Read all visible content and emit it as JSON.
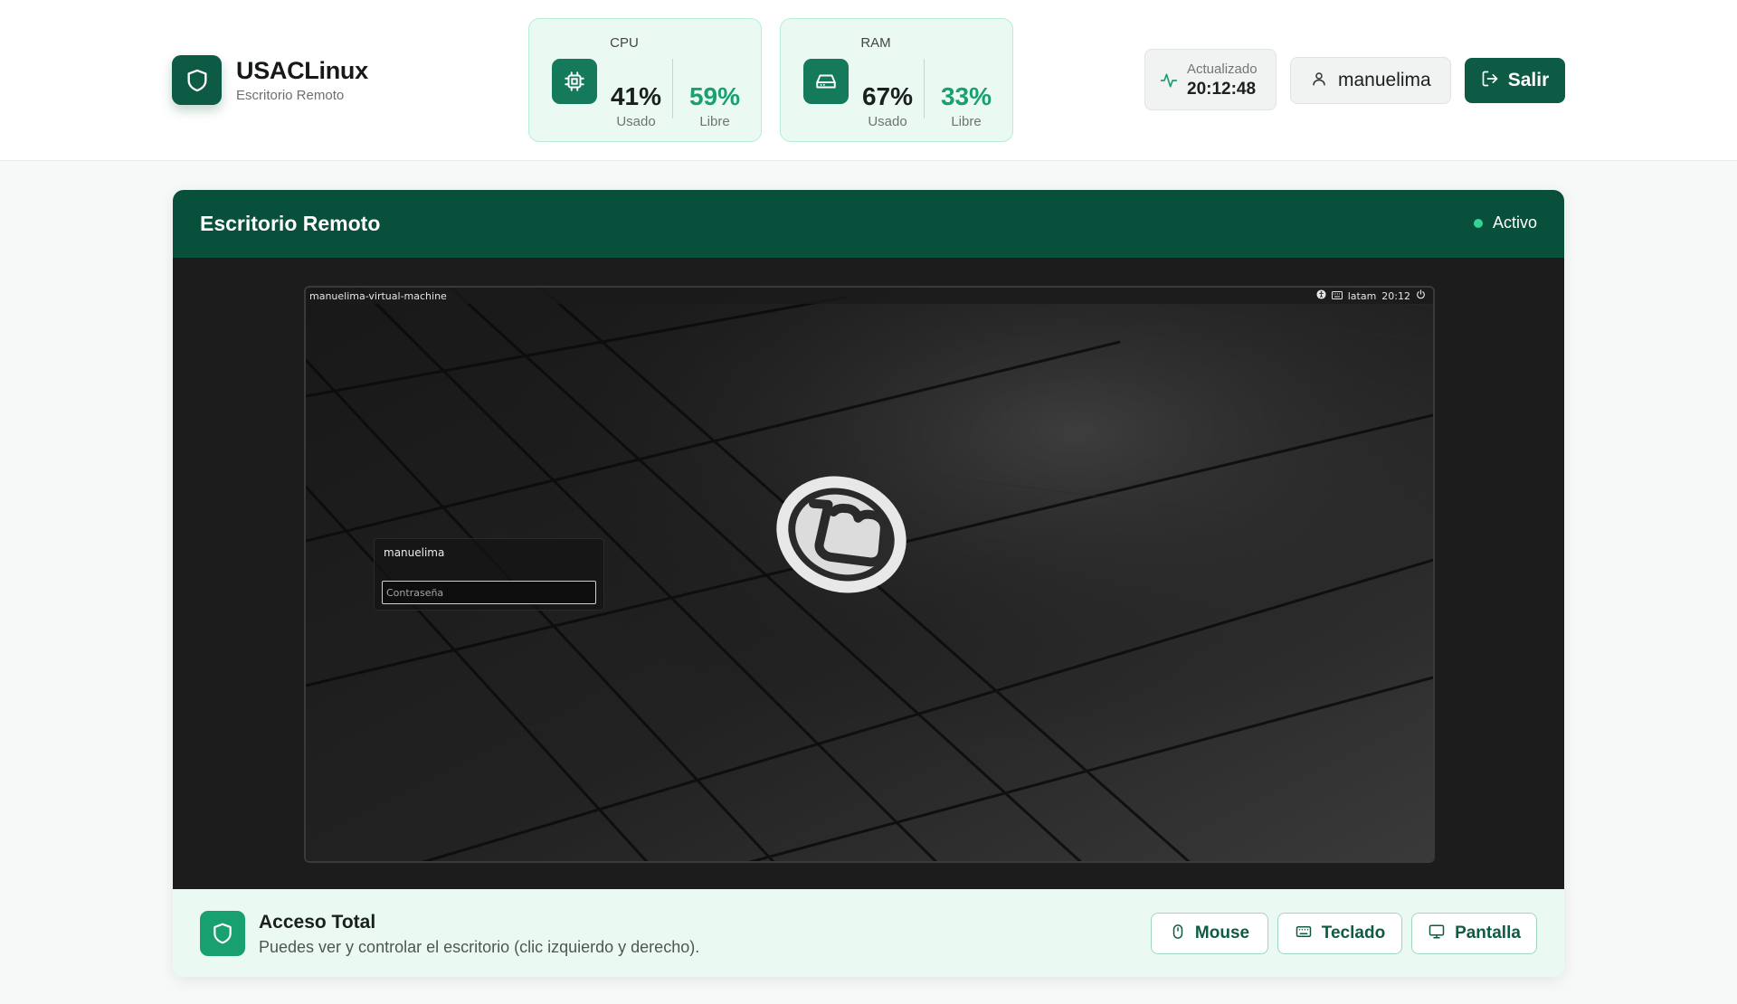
{
  "brand": {
    "title": "USACLinux",
    "subtitle": "Escritorio Remoto",
    "icon": "shield-icon"
  },
  "stats": {
    "cpu": {
      "label": "CPU",
      "icon": "cpu-chip-icon",
      "used": "41%",
      "used_label": "Usado",
      "free": "59%",
      "free_label": "Libre"
    },
    "ram": {
      "label": "RAM",
      "icon": "hard-drive-icon",
      "used": "67%",
      "used_label": "Usado",
      "free": "33%",
      "free_label": "Libre"
    }
  },
  "updated": {
    "label": "Actualizado",
    "time": "20:12:48",
    "icon": "activity-icon"
  },
  "user": {
    "name": "manuelima",
    "icon": "user-icon"
  },
  "logout": {
    "label": "Salir",
    "icon": "log-out-icon"
  },
  "panel": {
    "title": "Escritorio Remoto",
    "status": "Activo",
    "status_color": "#32d596"
  },
  "remote": {
    "hostname": "manuelima-virtual-machine",
    "keyboard_layout": "latam",
    "clock": "20:12",
    "login_user": "manuelima",
    "password_placeholder": "Contraseña"
  },
  "footer": {
    "title": "Acceso Total",
    "description": "Puedes ver y controlar el escritorio (clic izquierdo y derecho).",
    "buttons": {
      "mouse": "Mouse",
      "keyboard": "Teclado",
      "screen": "Pantalla"
    }
  },
  "colors": {
    "primary": "#0d5b44",
    "accent": "#18a070",
    "card_bg": "#eafaf3"
  }
}
